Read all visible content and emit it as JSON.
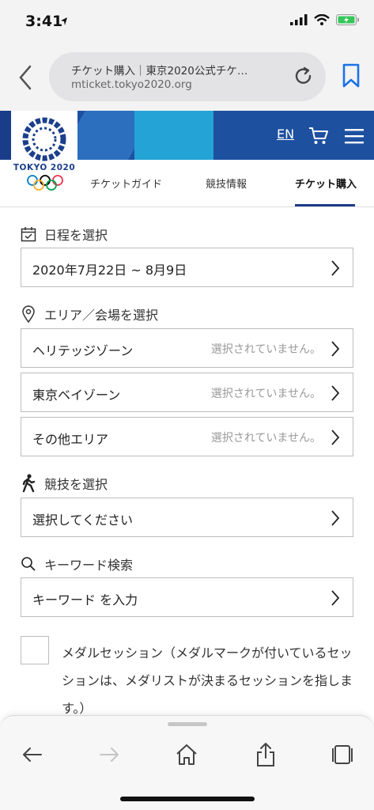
{
  "status_bar": {
    "time": "3:41"
  },
  "browser": {
    "page_title": "チケット購入｜東京2020公式チケ…",
    "host": "mticket.tokyo2020.org"
  },
  "site": {
    "logo_text": "TOKYO 2020",
    "lang_label": "EN",
    "tabs": [
      {
        "label": "チケットガイド"
      },
      {
        "label": "競技情報"
      },
      {
        "label": "チケット購入",
        "active": true
      }
    ]
  },
  "filters": {
    "date": {
      "label": "日程を選択",
      "value": "2020年7月22日 ~ 8月9日"
    },
    "area": {
      "label": "エリア／会場を選択",
      "items": [
        {
          "name": "ヘリテッジゾーン",
          "status": "選択されていません。"
        },
        {
          "name": "東京ベイゾーン",
          "status": "選択されていません。"
        },
        {
          "name": "その他エリア",
          "status": "選択されていません。"
        }
      ]
    },
    "sport": {
      "label": "競技を選択",
      "value": "選択してください"
    },
    "keyword": {
      "label": "キーワード検索",
      "value": "キーワード を入力"
    },
    "medal": {
      "text": "メダルセッション（メダルマークが付いているセッションは、メダリストが決まるセッションを指します。）",
      "checked": false
    }
  },
  "colors": {
    "brand": "#1e50a0",
    "accent": "#007aff",
    "battery": "#34c759"
  }
}
